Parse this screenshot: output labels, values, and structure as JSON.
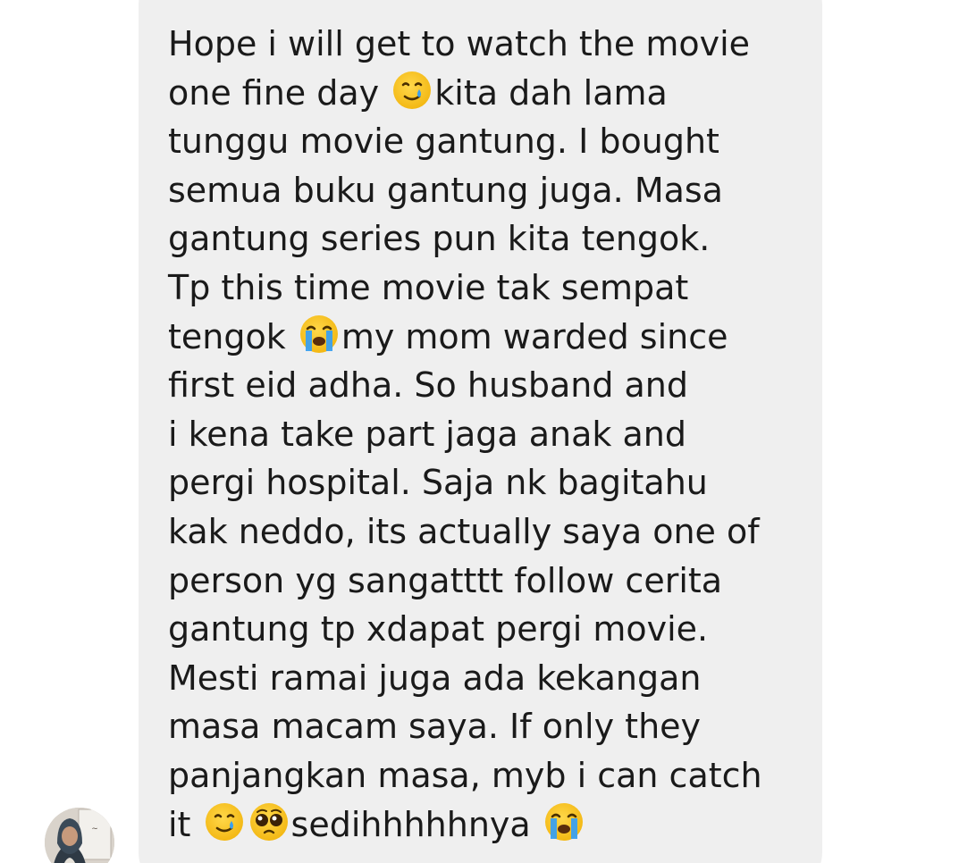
{
  "message": {
    "lines": [
      "Hope i will get to watch the movie",
      [
        "one fine day ",
        "kita dah lama"
      ],
      "tunggu movie gantung. I bought",
      "semua buku gantung juga. Masa",
      "gantung series pun kita tengok.",
      "Tp this time movie tak sempat",
      [
        "tengok ",
        "my mom warded since"
      ],
      "first eid adha. So husband and",
      "i kena take part jaga anak and",
      "pergi hospital. Saja nk bagitahu",
      "kak neddo, its actually saya one of",
      "person yg sangatttt follow cerita",
      "gantung tp xdapat pergi movie.",
      "Mesti ramai juga ada kekangan",
      "masa macam saya. If only they",
      "panjangkan masa, myb i can catch",
      [
        "it ",
        "sedihhhhhnya "
      ]
    ]
  },
  "emojis": {
    "line2": "smiling-face-with-tear",
    "line7": "loudly-crying-face",
    "line17_a": "smiling-face-with-tear",
    "line17_b": "pleading-face",
    "line17_c": "loudly-crying-face"
  },
  "colors": {
    "bubble": "#efefef",
    "text": "#1a1a1a",
    "emoji_yellow": "#f8c21b",
    "tear_blue": "#3aa0f0"
  }
}
